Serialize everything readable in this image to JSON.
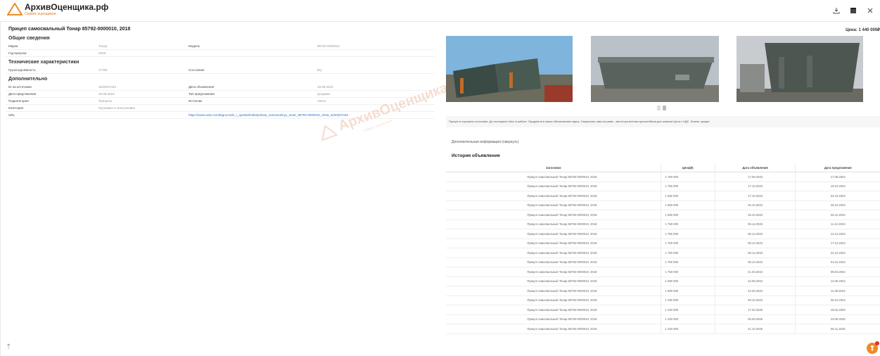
{
  "header": {
    "logo_title": "АрхивОценщика.рф",
    "logo_sub": "Сервис оценщиков",
    "download_icon": "download-icon",
    "dark_icon": "window-icon",
    "close_icon": "close-icon"
  },
  "listing": {
    "title": "Прицеп самосвальный Тонар 85792-0000010, 2018",
    "price": "Цена: 1 440 000₽"
  },
  "sections": {
    "general": "Общие сведения",
    "technical": "Технические характеристики",
    "additional": "Дополнительно"
  },
  "general_rows": [
    {
      "k1": "Марка",
      "v1": "Тонар",
      "k2": "Модель",
      "v2": "85792-0000010"
    },
    {
      "k1": "Год выпуска",
      "v1": "2018",
      "k2": "",
      "v2": ""
    }
  ],
  "technical_rows": [
    {
      "k1": "Грузоподъёмность",
      "v1": "17750",
      "k2": "Состояние",
      "v2": "Б/у"
    }
  ],
  "additional_rows": [
    {
      "k1": "ID на источнике",
      "v1": "3220037443",
      "k2": "Дата объявления",
      "v2": "18.08.2023"
    },
    {
      "k1": "Дата предложения",
      "v1": "29.08.2023",
      "k2": "Тип предложения",
      "v2": "продажа"
    },
    {
      "k1": "Подкатегория",
      "v1": "Прицепы",
      "k2": "Источник",
      "v2": "Авито"
    },
    {
      "k1": "Категория",
      "v1": "Грузовики и спецтехника",
      "k2": "",
      "v2": ""
    }
  ],
  "url_row": {
    "label": "URL",
    "value": "https://www.avito.ru/ufa/gruzoviki_i_spetstehnika/pritsep_samosvalnyy_tonar_85792-0000010_2018_3220037443"
  },
  "description": "Прицеп в хорошем состоянии. До последнего был в работе. Продается в связи обновлением парка. Сварочные швы на раме - места крепления кронштейнов для запаски Цена с НДС. Лизинг, кредит.",
  "more_link": "Дополнительная информация (свернуть)",
  "history": {
    "title": "История объявления",
    "headers": [
      "Заголовок",
      "Цена(₽)",
      "Дата объявления",
      "Дата предложения"
    ],
    "rows": [
      [
        "Прицеп самосвальный Тонар 85792-0000010, 2018",
        "1 750 000",
        "17.08.2023",
        "17.08.2023"
      ],
      [
        "Прицеп самосвальный Тонар 85792-0000010, 2018",
        "1 750 000",
        "17.10.2023",
        "19.10.2023"
      ],
      [
        "Прицеп самосвальный Тонар 85792-0000010, 2018",
        "1 650 000",
        "17.10.2023",
        "24.10.2023"
      ],
      [
        "Прицеп самосвальный Тонар 85792-0000010, 2018",
        "1 650 000",
        "25.10.2023",
        "29.10.2023"
      ],
      [
        "Прицеп самосвальный Тонар 85792-0000010, 2018",
        "1 650 000",
        "25.10.2023",
        "05.11.2023"
      ],
      [
        "Прицеп самосвальный Тонар 85792-0000010, 2018",
        "1 750 000",
        "06.12.2023",
        "11.12.2023"
      ],
      [
        "Прицеп самосвальный Тонар 85792-0000010, 2018",
        "1 750 000",
        "06.12.2023",
        "14.12.2023"
      ],
      [
        "Прицеп самосвальный Тонар 85792-0000010, 2018",
        "1 750 000",
        "06.12.2023",
        "17.12.2023"
      ],
      [
        "Прицеп самосвальный Тонар 85792-0000010, 2018",
        "1 750 000",
        "06.12.2023",
        "24.12.2023"
      ],
      [
        "Прицеп самосвальный Тонар 85792-0000010, 2018",
        "1 750 000",
        "06.12.2023",
        "01.01.2024"
      ],
      [
        "Прицеп самосвальный Тонар 85792-0000010, 2018",
        "1 750 000",
        "21.03.2024",
        "09.04.2024"
      ],
      [
        "Прицеп самосвальный Тонар 85792-0000010, 2018",
        "1 690 000",
        "22.05.2024",
        "12.06.2024"
      ],
      [
        "Прицеп самосвальный Тонар 85792-0000010, 2018",
        "1 690 000",
        "22.05.2024",
        "11.08.2024"
      ],
      [
        "Прицеп самосвальный Тонар 85792-0000010, 2018",
        "1 490 000",
        "09.10.2024",
        "25.10.2024"
      ],
      [
        "Прицеп самосвальный Тонар 85792-0000010, 2018",
        "1 440 000",
        "17.02.2025",
        "19.02.2025"
      ],
      [
        "Прицеп самосвальный Тонар 85792-0000010, 2018",
        "1 440 000",
        "05.05.2025",
        "23.05.2025"
      ],
      [
        "Прицеп самосвальный Тонар 85792-0000010, 2018",
        "1 440 000",
        "21.10.2025",
        "06.11.2025"
      ]
    ]
  },
  "watermark": {
    "text": "АрхивОценщика.рф",
    "sub": "Сервис оценщиков"
  },
  "colors": {
    "accent": "#f08a24",
    "link": "#2a6fd6"
  }
}
